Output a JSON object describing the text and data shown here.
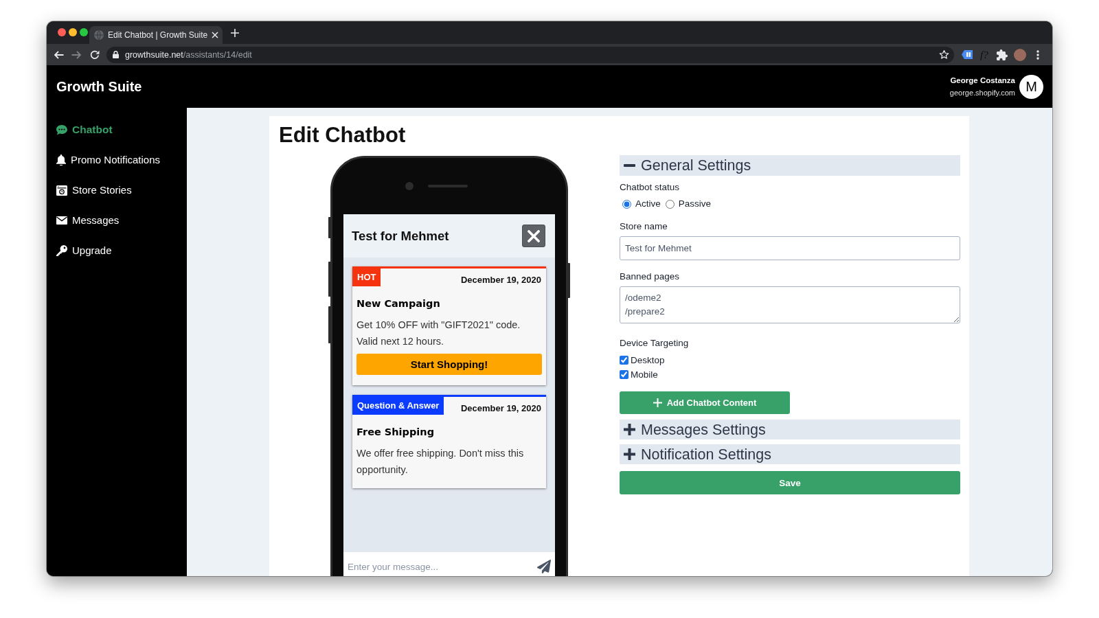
{
  "browser": {
    "tab_title": "Edit Chatbot | Growth Suite",
    "forward_disabled": true,
    "url_host": "growthsuite.net",
    "url_path": "/assistants/14/edit",
    "extension_text": "f?"
  },
  "header": {
    "brand": "Growth Suite",
    "user_name": "George Costanza",
    "user_email": "george.shopify.com",
    "avatar_letter": "M"
  },
  "sidebar": {
    "items": [
      {
        "label": "Chatbot",
        "selected": true
      },
      {
        "label": "Promo Notifications",
        "selected": false
      },
      {
        "label": "Store Stories",
        "selected": false
      },
      {
        "label": "Messages",
        "selected": false
      },
      {
        "label": "Upgrade",
        "selected": false
      }
    ]
  },
  "page": {
    "title": "Edit Chatbot"
  },
  "preview": {
    "chat_title": "Test for Mehmet",
    "cards": [
      {
        "tag": "HOT",
        "color": "#f5340f",
        "date": "December 19, 2020",
        "title": "New Campaign",
        "text": "Get 10% OFF with \"GIFT2021\" code. Valid next 12 hours.",
        "button": "Start Shopping!"
      },
      {
        "tag": "Question & Answer",
        "color": "#0b3bff",
        "date": "December 19, 2020",
        "title": "Free Shipping",
        "text": "We offer free shipping. Don't miss this opportunity."
      }
    ],
    "message": {
      "placeholder": "Enter your message..."
    }
  },
  "settings": {
    "sections": [
      {
        "title": "General Settings",
        "expanded": true,
        "status": {
          "label": "Chatbot status",
          "options": [
            {
              "label": "Active",
              "selected": true
            },
            {
              "label": "Passive",
              "selected": false
            }
          ]
        },
        "store_name": {
          "label": "Store name",
          "value": "Test for Mehmet"
        },
        "banned_pages": {
          "label": "Banned pages",
          "value": "/odeme2\n/prepare2"
        },
        "device_targeting": {
          "label": "Device Targeting",
          "options": [
            {
              "label": "Desktop",
              "checked": true
            },
            {
              "label": "Mobile",
              "checked": true
            }
          ]
        },
        "add_button": "Add Chatbot Content"
      },
      {
        "title": "Messages Settings",
        "expanded": false
      },
      {
        "title": "Notification Settings",
        "expanded": false
      }
    ],
    "save_button": "Save"
  }
}
